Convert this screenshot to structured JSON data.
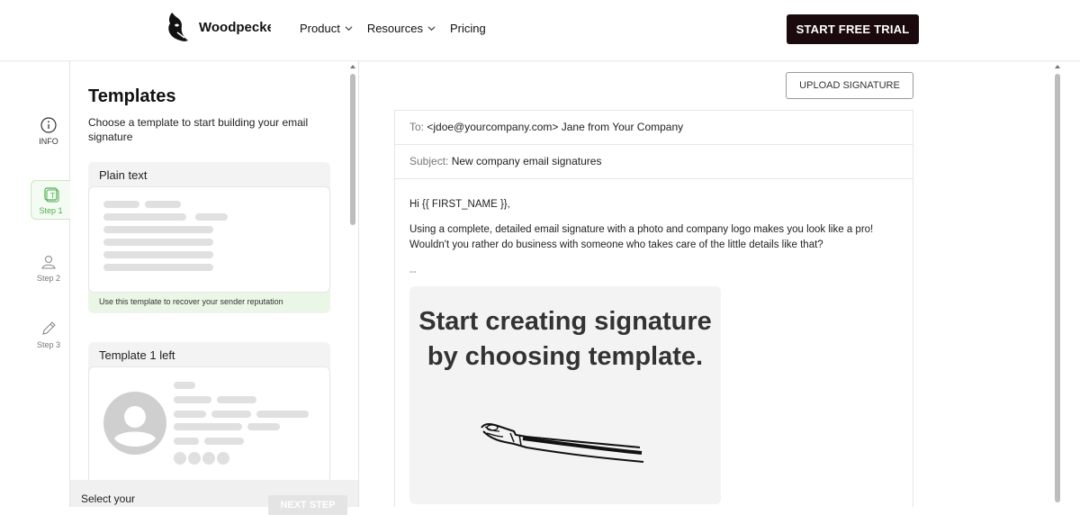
{
  "header": {
    "brand": "Woodpecker",
    "nav": [
      {
        "label": "Product",
        "has_dropdown": true
      },
      {
        "label": "Resources",
        "has_dropdown": true
      },
      {
        "label": "Pricing",
        "has_dropdown": false
      }
    ],
    "cta_label": "START FREE TRIAL"
  },
  "rail": {
    "items": [
      {
        "label": "INFO",
        "icon": "info-icon"
      },
      {
        "label": "Step 1",
        "icon": "template-icon",
        "active": true
      },
      {
        "label": "Step 2",
        "icon": "user-icon"
      },
      {
        "label": "Step 3",
        "icon": "pencil-icon"
      }
    ]
  },
  "templates": {
    "title": "Templates",
    "subtitle": "Choose a template to start building your email signature",
    "cards": [
      {
        "title": "Plain text",
        "note": "Use this template to recover your sender reputation"
      },
      {
        "title": "Template 1 left",
        "note": ""
      }
    ],
    "footer_text": "Select your",
    "next_label": "NEXT STEP"
  },
  "preview": {
    "upload_label": "UPLOAD SIGNATURE",
    "to_label": "To:",
    "to_value": "<jdoe@yourcompany.com> Jane from Your Company",
    "subject_label": "Subject:",
    "subject_value": "New company email signatures",
    "greeting": "Hi {{ FIRST_NAME }},",
    "paragraph": "Using a complete, detailed email signature with a photo and company logo makes you look like a pro! Wouldn't you rather do business with someone who takes care of the little details like that?",
    "separator": "--",
    "placeholder_message": "Start creating signature by choosing template."
  },
  "colors": {
    "cta_bg": "#1a0a0d",
    "active_step": "#4caf50",
    "active_note_bg": "#eaf6e6"
  }
}
